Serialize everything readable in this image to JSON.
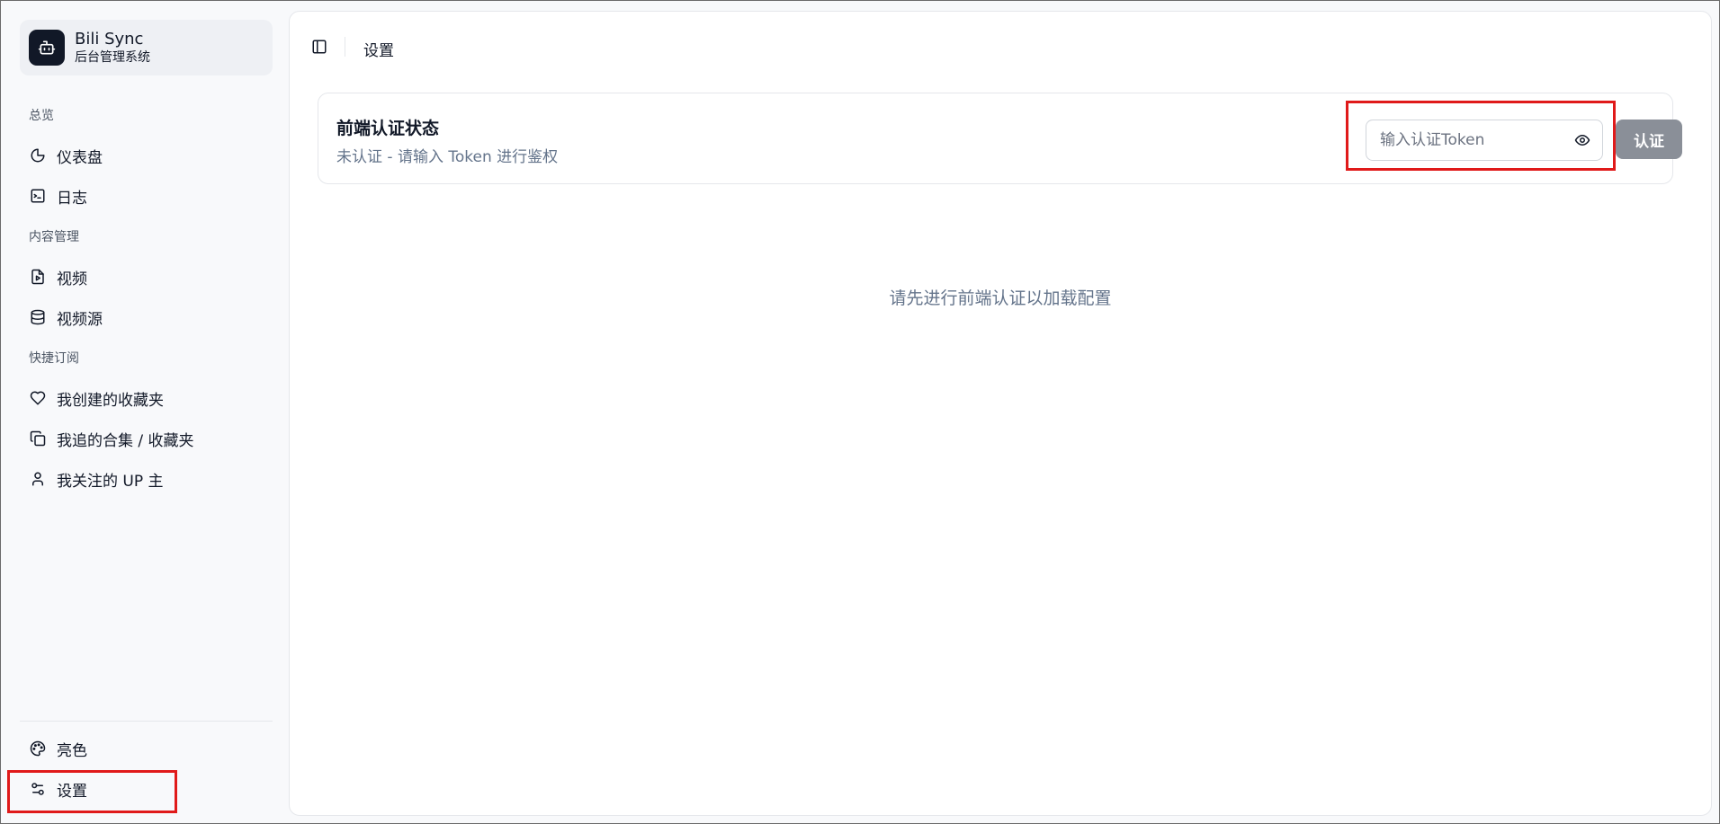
{
  "app": {
    "title": "Bili Sync",
    "subtitle": "后台管理系统"
  },
  "sidebar": {
    "groups": [
      {
        "label": "总览",
        "items": [
          {
            "label": "仪表盘",
            "icon": "pie-chart-icon"
          },
          {
            "label": "日志",
            "icon": "terminal-icon"
          }
        ]
      },
      {
        "label": "内容管理",
        "items": [
          {
            "label": "视频",
            "icon": "video-file-icon"
          },
          {
            "label": "视频源",
            "icon": "database-icon"
          }
        ]
      },
      {
        "label": "快捷订阅",
        "items": [
          {
            "label": "我创建的收藏夹",
            "icon": "heart-icon"
          },
          {
            "label": "我追的合集 / 收藏夹",
            "icon": "copy-icon"
          },
          {
            "label": "我关注的 UP 主",
            "icon": "user-icon"
          }
        ]
      }
    ],
    "footer": [
      {
        "label": "亮色",
        "icon": "palette-icon"
      },
      {
        "label": "设置",
        "icon": "sliders-icon"
      }
    ]
  },
  "header": {
    "title": "设置",
    "toggle_icon": "sidebar-toggle-icon"
  },
  "auth": {
    "title": "前端认证状态",
    "status": "未认证 - 请输入 Token 进行鉴权",
    "token_placeholder": "输入认证Token",
    "token_value": "",
    "button_label": "认证"
  },
  "main": {
    "empty_message": "请先进行前端认证以加载配置"
  },
  "colors": {
    "highlight": "#e01a1a",
    "button_disabled": "#8a8f98",
    "muted_text": "#64748b"
  }
}
